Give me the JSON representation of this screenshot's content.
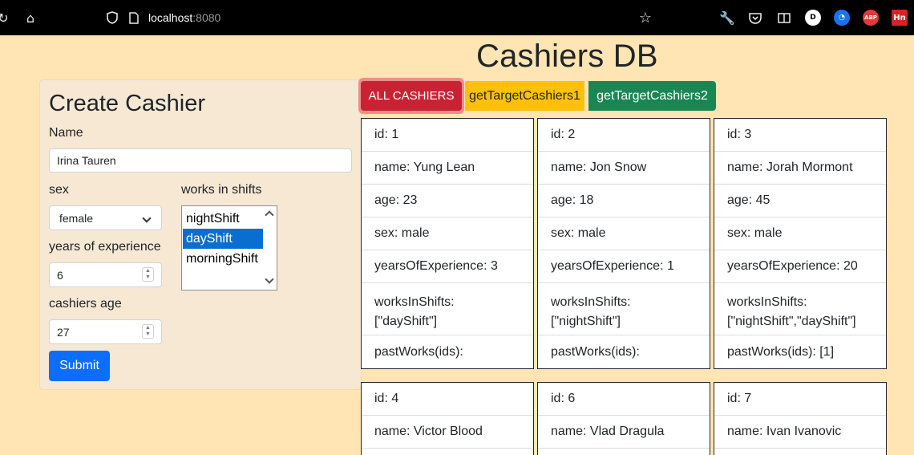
{
  "browser": {
    "url_host": "localhost",
    "url_port": ":8080",
    "ext_d": "D",
    "ext_abp": "ABP",
    "ext_hn": "Hn"
  },
  "page_title": "Cashiers DB",
  "form": {
    "title": "Create Cashier",
    "name_label": "Name",
    "name_value": "Irina Tauren",
    "sex_label": "sex",
    "sex_value": "female",
    "shifts_label": "works in shifts",
    "shift_options": [
      "nightShift",
      "dayShift",
      "morningShift"
    ],
    "shift_selected": "dayShift",
    "experience_label": "years of experience",
    "experience_value": "6",
    "age_label": "cashiers age",
    "age_value": "27",
    "submit_label": "Submit"
  },
  "filter_buttons": {
    "all": "ALL CASHIERS",
    "target1": "getTargetCashiers1",
    "target2": "getTargetCashiers2"
  },
  "cashiers": [
    {
      "id": "id: 1",
      "name": "name: Yung Lean",
      "age": "age: 23",
      "sex": "sex: male",
      "exp": "yearsOfExperience: 3",
      "shifts_label": "worksInShifts:",
      "shifts": "[\"dayShift\"]",
      "past": "pastWorks(ids):"
    },
    {
      "id": "id: 2",
      "name": "name: Jon Snow",
      "age": "age: 18",
      "sex": "sex: male",
      "exp": "yearsOfExperience: 1",
      "shifts_label": "worksInShifts:",
      "shifts": "[\"nightShift\"]",
      "past": "pastWorks(ids):"
    },
    {
      "id": "id: 3",
      "name": "name: Jorah Mormont",
      "age": "age: 45",
      "sex": "sex: male",
      "exp": "yearsOfExperience: 20",
      "shifts_label": "worksInShifts:",
      "shifts": "[\"nightShift\",\"dayShift\"]",
      "past": "pastWorks(ids): [1]"
    },
    {
      "id": "id: 4",
      "name": "name: Victor Blood"
    },
    {
      "id": "id: 6",
      "name": "name: Vlad Dragula"
    },
    {
      "id": "id: 7",
      "name": "name: Ivan Ivanovic"
    }
  ],
  "colors": {
    "page_bg": "#fee5b3",
    "all_btn": "#c82333",
    "target1_btn": "#ffc107",
    "target2_btn": "#198754",
    "submit_btn": "#0d6efd"
  }
}
